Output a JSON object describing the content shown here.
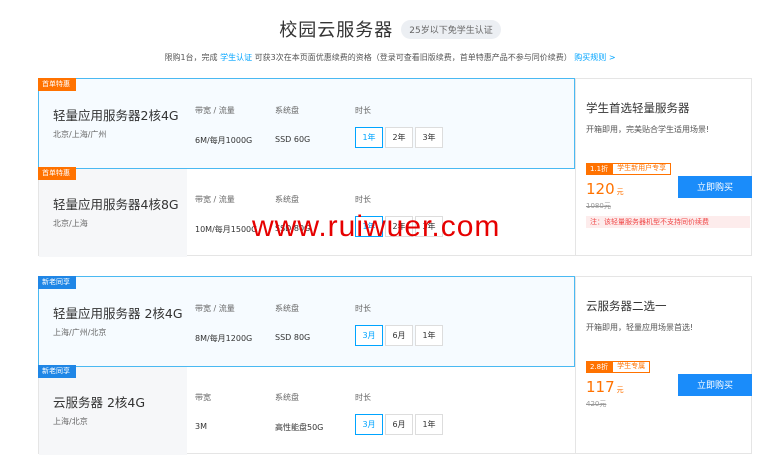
{
  "header": {
    "title": "校园云服务器",
    "badge": "25岁以下免学生认证",
    "notice_prefix": "限购1台，完成 ",
    "notice_link": "学生认证",
    "notice_middle": " 可获3次在本页面优惠续费的资格（登录可查看旧版续费，首单特惠产品不参与同价续费）",
    "rules_link": "购买规则 >"
  },
  "section1": {
    "plans": [
      {
        "tag": "首单特惠",
        "name": "轻量应用服务器2核4G",
        "region": "北京/上海/广州",
        "bandwidth_label": "带宽 / 流量",
        "bandwidth_value": "6M/每月1000G",
        "disk_label": "系统盘",
        "disk_value": "SSD 60G",
        "duration_label": "时长",
        "durations": [
          "1年",
          "2年",
          "3年"
        ]
      },
      {
        "tag": "首单特惠",
        "name": "轻量应用服务器4核8G",
        "region": "北京/上海",
        "bandwidth_label": "带宽 / 流量",
        "bandwidth_value": "10M/每月1500G",
        "disk_label": "系统盘",
        "disk_value": "SSD 80G",
        "duration_label": "时长",
        "durations": [
          "1年",
          "2年",
          "3年"
        ]
      }
    ],
    "side": {
      "title": "学生首选轻量服务器",
      "subtitle": "开箱即用，完美贴合学生适用场景!",
      "discount": "1.1折",
      "discount_label": "学生新用户专享",
      "price": "120",
      "unit": "元",
      "original": "1080元",
      "buy": "立即购买",
      "note": "注：该轻量服务器机型不支持同价续费"
    }
  },
  "section2": {
    "plans": [
      {
        "tag": "新老同享",
        "name": "轻量应用服务器 2核4G",
        "region": "上海/广州/北京",
        "bandwidth_label": "带宽 / 流量",
        "bandwidth_value": "8M/每月1200G",
        "disk_label": "系统盘",
        "disk_value": "SSD 80G",
        "duration_label": "时长",
        "durations": [
          "3月",
          "6月",
          "1年"
        ]
      },
      {
        "tag": "新老同享",
        "name": "云服务器 2核4G",
        "region": "上海/北京",
        "bandwidth_label": "带宽",
        "bandwidth_value": "3M",
        "disk_label": "系统盘",
        "disk_value": "高性能盘50G",
        "duration_label": "时长",
        "durations": [
          "3月",
          "6月",
          "1年"
        ]
      }
    ],
    "side": {
      "title": "云服务器二选一",
      "subtitle": "开箱即用，轻量应用场景首选!",
      "discount": "2.8折",
      "discount_label": "学生专属",
      "price": "117",
      "unit": "元",
      "original": "420元",
      "buy": "立即购买"
    }
  },
  "watermark": "www.ruiwuer.com",
  "colors": {
    "accent": "#00a4ff",
    "orange": "#ff7200",
    "buy": "#1a8cfa",
    "tag_blue": "#1f86e6"
  }
}
